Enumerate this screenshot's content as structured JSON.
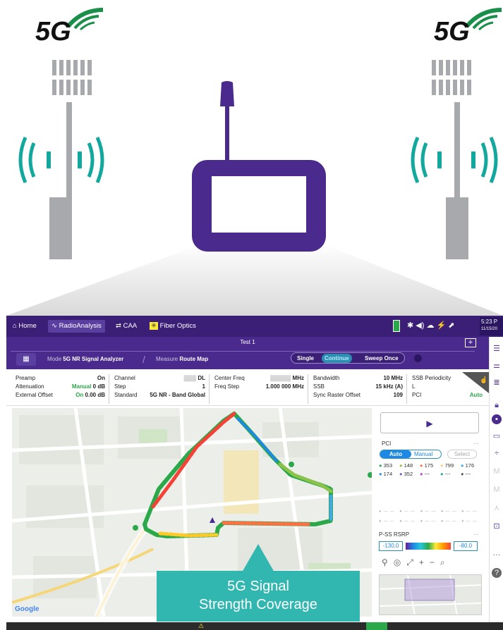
{
  "badges": {
    "left": "5G",
    "right": "5G"
  },
  "topbar": {
    "home": "Home",
    "radio": "RadioAnalysis",
    "caa": "CAA",
    "fiber": "Fiber Optics",
    "time": "5:23 P",
    "date": "11/15/20"
  },
  "header": {
    "test_title": "Test 1",
    "mode_label": "Mode",
    "mode_value": "5G NR Signal Analyzer",
    "measure_label": "Measure",
    "measure_value": "Route Map",
    "single": "Single",
    "continue": "Continue",
    "sweep_once": "Sweep Once",
    "add": "+"
  },
  "params": {
    "preamp_label": "Preamp",
    "preamp_value": "On",
    "atten_label": "Attenuation",
    "atten_mode": "Manual",
    "atten_value": "0 dB",
    "extoff_label": "External Offset",
    "extoff_state": "On",
    "extoff_value": "0.00 dB",
    "channel_label": "Channel",
    "channel_value": "DL",
    "step_label": "Step",
    "step_value": "1",
    "standard_label": "Standard",
    "standard_value": "5G NR - Band Global",
    "cfreq_label": "Center Freq",
    "cfreq_value": "MHz",
    "fstep_label": "Freq Step",
    "fstep_value": "1.000 000 MHz",
    "bw_label": "Bandwidth",
    "bw_value": "10 MHz",
    "ssb_label": "SSB",
    "ssb_value": "15 kHz (A)",
    "sync_label": "Sync Raster Offset",
    "sync_value": "109",
    "ssbp_label": "SSB Periodicity",
    "ssbp_value": "L",
    "pci_label": "PCI",
    "pci_value": "Auto"
  },
  "panel": {
    "pci_title": "PCI",
    "auto": "Auto",
    "manual": "Manual",
    "select": "Select",
    "pci_items": [
      {
        "v": "353",
        "c": "#2aa84a"
      },
      {
        "v": "148",
        "c": "#8bc34a"
      },
      {
        "v": "175",
        "c": "#ff7043"
      },
      {
        "v": "799",
        "c": "#ffcc80"
      },
      {
        "v": "176",
        "c": "#42a5f5"
      },
      {
        "v": "174",
        "c": "#1e88e5"
      },
      {
        "v": "352",
        "c": "#7e57c2"
      },
      {
        "v": "---",
        "c": "#ab47bc"
      },
      {
        "v": "---",
        "c": "#26a69a"
      },
      {
        "v": "---",
        "c": "#555555"
      }
    ],
    "rsrp_title": "P-SS RSRP",
    "rsrp_min": "-130.0",
    "rsrp_max": "-80.0"
  },
  "map": {
    "google": "Google"
  },
  "callout": {
    "line1": "5G Signal",
    "line2": "Strength Coverage"
  },
  "colors": {
    "purple": "#4a2a8c",
    "teal": "#13a89e",
    "gray": "#a7a9ac",
    "green_5g": "#1a8f4a"
  }
}
